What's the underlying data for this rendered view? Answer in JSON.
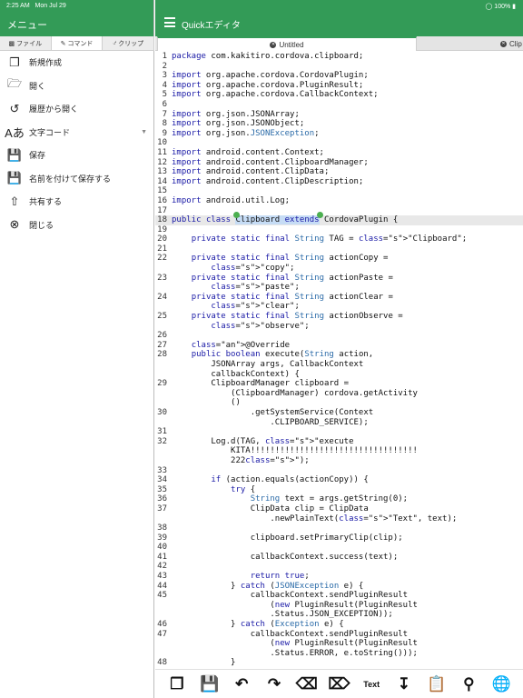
{
  "status": {
    "time": "2:25 AM",
    "date": "Mon Jul 29",
    "battery": "100%"
  },
  "sidebar": {
    "title": "メニュー",
    "tabs": [
      {
        "label": "ファイル"
      },
      {
        "label": "コマンド"
      },
      {
        "label": "クリップ"
      }
    ],
    "items": [
      {
        "label": "新規作成",
        "icon": "new-file-icon"
      },
      {
        "label": "開く",
        "icon": "folder-open-icon"
      },
      {
        "label": "履歴から開く",
        "icon": "history-icon"
      },
      {
        "label": "文字コード",
        "icon": "encoding-icon"
      },
      {
        "label": "保存",
        "icon": "save-icon"
      },
      {
        "label": "名前を付けて保存する",
        "icon": "save-as-icon"
      },
      {
        "label": "共有する",
        "icon": "share-icon"
      },
      {
        "label": "閉じる",
        "icon": "close-circle-icon"
      }
    ]
  },
  "header": {
    "title": "Quickエディタ"
  },
  "file_tabs": [
    {
      "label": "Untitled"
    },
    {
      "label": "Clip"
    }
  ],
  "editor": {
    "lines": [
      {
        "n": "1",
        "c": "package com.kakitiro.cordova.clipboard;"
      },
      {
        "n": "2",
        "c": ""
      },
      {
        "n": "3",
        "c": "import org.apache.cordova.CordovaPlugin;"
      },
      {
        "n": "4",
        "c": "import org.apache.cordova.PluginResult;"
      },
      {
        "n": "5",
        "c": "import org.apache.cordova.CallbackContext;"
      },
      {
        "n": "6",
        "c": ""
      },
      {
        "n": "7",
        "c": "import org.json.JSONArray;"
      },
      {
        "n": "8",
        "c": "import org.json.JSONObject;"
      },
      {
        "n": "9",
        "c": "import org.json.JSONException;"
      },
      {
        "n": "10",
        "c": ""
      },
      {
        "n": "11",
        "c": "import android.content.Context;"
      },
      {
        "n": "12",
        "c": "import android.content.ClipboardManager;"
      },
      {
        "n": "13",
        "c": "import android.content.ClipData;"
      },
      {
        "n": "14",
        "c": "import android.content.ClipDescription;"
      },
      {
        "n": "15",
        "c": ""
      },
      {
        "n": "16",
        "c": "import android.util.Log;"
      },
      {
        "n": "17",
        "c": ""
      },
      {
        "n": "18",
        "c": "public class Clipboard extends CordovaPlugin {"
      },
      {
        "n": "19",
        "c": ""
      },
      {
        "n": "20",
        "c": "    private static final String TAG = \"Clipboard\";"
      },
      {
        "n": "21",
        "c": ""
      },
      {
        "n": "22",
        "c": "    private static final String actionCopy ="
      },
      {
        "n": "",
        "c": "        \"copy\";"
      },
      {
        "n": "23",
        "c": "    private static final String actionPaste ="
      },
      {
        "n": "",
        "c": "        \"paste\";"
      },
      {
        "n": "24",
        "c": "    private static final String actionClear ="
      },
      {
        "n": "",
        "c": "        \"clear\";"
      },
      {
        "n": "25",
        "c": "    private static final String actionObserve ="
      },
      {
        "n": "",
        "c": "        \"observe\";"
      },
      {
        "n": "26",
        "c": ""
      },
      {
        "n": "27",
        "c": "    @Override"
      },
      {
        "n": "28",
        "c": "    public boolean execute(String action,"
      },
      {
        "n": "",
        "c": "        JSONArray args, CallbackContext"
      },
      {
        "n": "",
        "c": "        callbackContext) {"
      },
      {
        "n": "29",
        "c": "        ClipboardManager clipboard ="
      },
      {
        "n": "",
        "c": "            (ClipboardManager) cordova.getActivity"
      },
      {
        "n": "",
        "c": "            ()"
      },
      {
        "n": "30",
        "c": "                .getSystemService(Context"
      },
      {
        "n": "",
        "c": "                    .CLIPBOARD_SERVICE);"
      },
      {
        "n": "31",
        "c": ""
      },
      {
        "n": "32",
        "c": "        Log.d(TAG, \"execute"
      },
      {
        "n": "",
        "c": "            KITA!!!!!!!!!!!!!!!!!!!!!!!!!!!!!!!!!!"
      },
      {
        "n": "",
        "c": "            222\");"
      },
      {
        "n": "33",
        "c": ""
      },
      {
        "n": "34",
        "c": "        if (action.equals(actionCopy)) {"
      },
      {
        "n": "35",
        "c": "            try {"
      },
      {
        "n": "36",
        "c": "                String text = args.getString(0);"
      },
      {
        "n": "37",
        "c": "                ClipData clip = ClipData"
      },
      {
        "n": "",
        "c": "                    .newPlainText(\"Text\", text);"
      },
      {
        "n": "38",
        "c": ""
      },
      {
        "n": "39",
        "c": "                clipboard.setPrimaryClip(clip);"
      },
      {
        "n": "40",
        "c": ""
      },
      {
        "n": "41",
        "c": "                callbackContext.success(text);"
      },
      {
        "n": "42",
        "c": ""
      },
      {
        "n": "43",
        "c": "                return true;"
      },
      {
        "n": "44",
        "c": "            } catch (JSONException e) {"
      },
      {
        "n": "45",
        "c": "                callbackContext.sendPluginResult"
      },
      {
        "n": "",
        "c": "                    (new PluginResult(PluginResult"
      },
      {
        "n": "",
        "c": "                    .Status.JSON_EXCEPTION));"
      },
      {
        "n": "46",
        "c": "            } catch (Exception e) {"
      },
      {
        "n": "47",
        "c": "                callbackContext.sendPluginResult"
      },
      {
        "n": "",
        "c": "                    (new PluginResult(PluginResult"
      },
      {
        "n": "",
        "c": "                    .Status.ERROR, e.toString()));"
      },
      {
        "n": "48",
        "c": "            }"
      }
    ]
  },
  "toolbar": {
    "buttons": [
      {
        "icon": "new-file-icon",
        "label": ""
      },
      {
        "icon": "save-icon",
        "label": ""
      },
      {
        "icon": "undo-icon",
        "label": ""
      },
      {
        "icon": "redo-icon",
        "label": ""
      },
      {
        "icon": "backspace-icon",
        "label": ""
      },
      {
        "icon": "delete-forward-icon",
        "label": ""
      },
      {
        "icon": "text-select-icon",
        "label": "Text"
      },
      {
        "icon": "paste-icon",
        "label": ""
      },
      {
        "icon": "clipboard-icon",
        "label": ""
      },
      {
        "icon": "search-icon",
        "label": ""
      },
      {
        "icon": "browser-icon",
        "label": ""
      }
    ]
  },
  "colors": {
    "accent": "#339b57",
    "selection": "#c6dcf5",
    "keyword": "#1a1aa6",
    "string": "#a31515"
  }
}
